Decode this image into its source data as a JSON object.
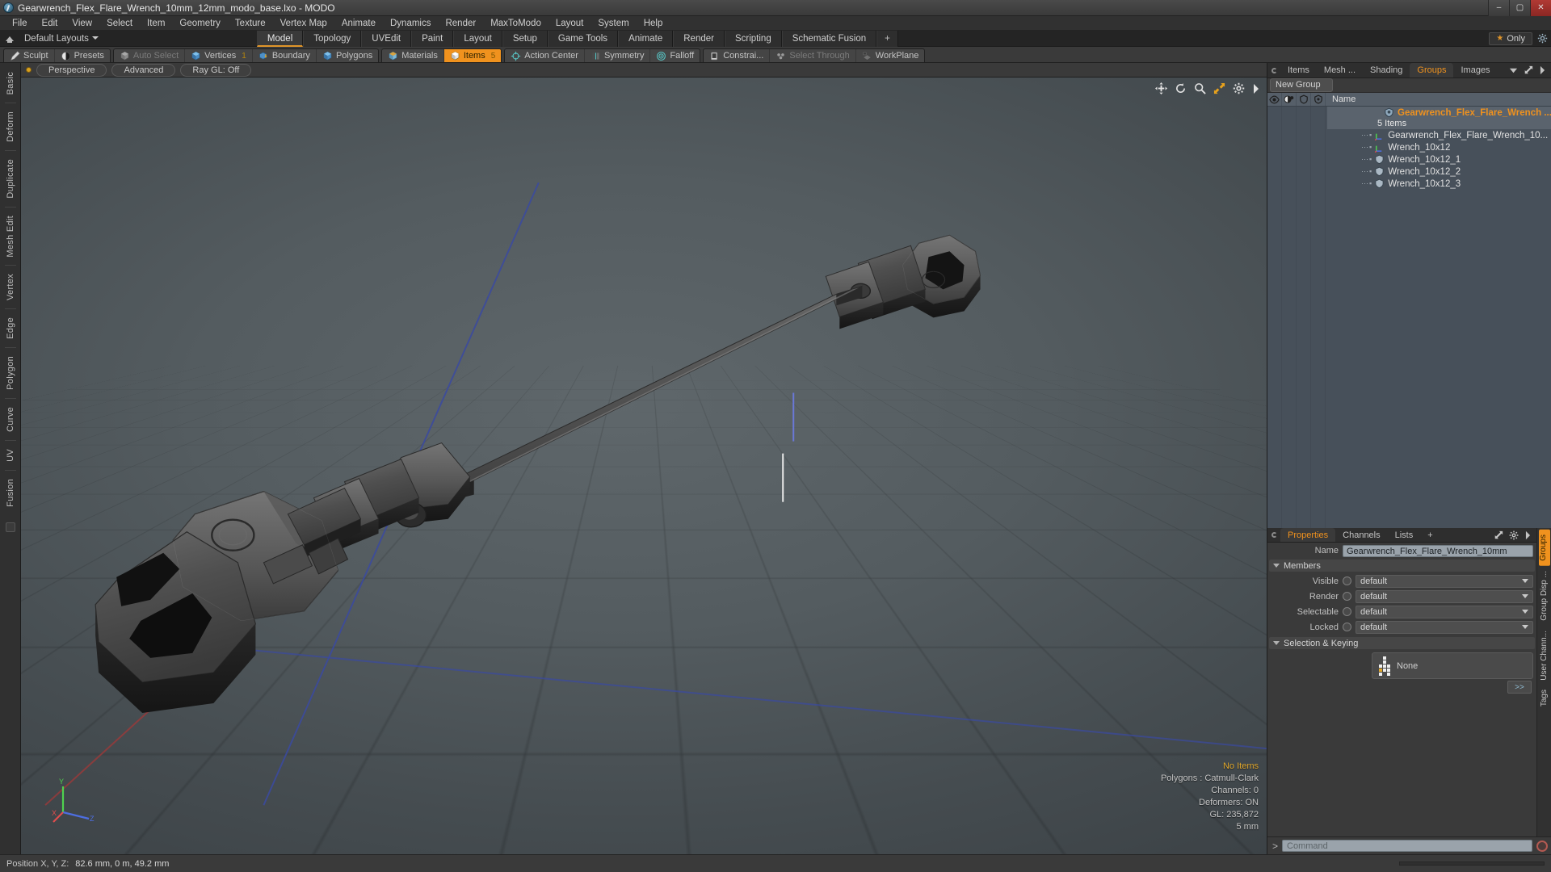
{
  "window": {
    "title": "Gearwrench_Flex_Flare_Wrench_10mm_12mm_modo_base.lxo - MODO",
    "minimize": "–",
    "maximize": "▢",
    "close": "✕"
  },
  "menubar": {
    "items": [
      "File",
      "Edit",
      "View",
      "Select",
      "Item",
      "Geometry",
      "Texture",
      "Vertex Map",
      "Animate",
      "Dynamics",
      "Render",
      "MaxToModo",
      "Layout",
      "System",
      "Help"
    ]
  },
  "layoutbar": {
    "home_label": "",
    "dropdown_label": "Default Layouts",
    "tabs": [
      {
        "label": "Model",
        "active": true
      },
      {
        "label": "Topology",
        "active": false
      },
      {
        "label": "UVEdit",
        "active": false
      },
      {
        "label": "Paint",
        "active": false
      },
      {
        "label": "Layout",
        "active": false
      },
      {
        "label": "Setup",
        "active": false
      },
      {
        "label": "Game Tools",
        "active": false
      },
      {
        "label": "Animate",
        "active": false
      },
      {
        "label": "Render",
        "active": false
      },
      {
        "label": "Scripting",
        "active": false
      },
      {
        "label": "Schematic Fusion",
        "active": false
      },
      {
        "label": "+",
        "active": false
      }
    ],
    "only_label": "Only"
  },
  "modebar": {
    "groups": [
      {
        "buttons": [
          {
            "label": "Sculpt",
            "icon": "pen-icon",
            "state": "normal",
            "count": ""
          },
          {
            "label": "Presets",
            "icon": "sphere-icon",
            "state": "normal",
            "count": ""
          }
        ]
      },
      {
        "buttons": [
          {
            "label": "Auto Select",
            "icon": "cube-gray-icon",
            "state": "disabled",
            "count": ""
          },
          {
            "label": "Vertices",
            "icon": "cube-blue-icon",
            "state": "normal",
            "count": "1"
          },
          {
            "label": "Boundary",
            "icon": "boundary-icon",
            "state": "normal",
            "count": ""
          },
          {
            "label": "Polygons",
            "icon": "cube-blue-icon",
            "state": "normal",
            "count": ""
          }
        ]
      },
      {
        "buttons": [
          {
            "label": "Materials",
            "icon": "cube-amber-icon",
            "state": "normal",
            "count": ""
          },
          {
            "label": "Items",
            "icon": "cube-white-icon",
            "state": "active",
            "count": "5"
          }
        ]
      },
      {
        "buttons": [
          {
            "label": "Action Center",
            "icon": "crosshair-icon",
            "state": "normal",
            "count": ""
          },
          {
            "label": "Symmetry",
            "icon": "symmetry-icon",
            "state": "normal",
            "count": ""
          },
          {
            "label": "Falloff",
            "icon": "target-icon",
            "state": "normal",
            "count": ""
          }
        ]
      },
      {
        "buttons": [
          {
            "label": "Constrai...",
            "icon": "constraint-icon",
            "state": "normal",
            "count": ""
          },
          {
            "label": "Select Through",
            "icon": "select-through-icon",
            "state": "disabled",
            "count": ""
          },
          {
            "label": "WorkPlane",
            "icon": "workplane-icon",
            "state": "normal",
            "count": ""
          }
        ]
      }
    ]
  },
  "leftstrip": {
    "tabs": [
      "Basic",
      "Deform",
      "Duplicate",
      "Mesh Edit",
      "Vertex",
      "Edge",
      "Polygon",
      "Curve",
      "UV",
      "Fusion"
    ]
  },
  "viewport": {
    "header": {
      "view_mode": "Perspective",
      "shading": "Advanced",
      "raygl": "Ray GL: Off"
    },
    "icons": [
      "move-icon",
      "rotate-icon",
      "zoom-icon",
      "fit-icon",
      "gear-icon",
      "chevron-right-icon"
    ],
    "stats": {
      "selection": "No Items",
      "polygons": "Polygons : Catmull-Clark",
      "channels": "Channels: 0",
      "deformers": "Deformers: ON",
      "gl": "GL: 235,872",
      "scale": "5 mm"
    },
    "axis_labels": {
      "x": "X",
      "y": "Y",
      "z": "Z"
    }
  },
  "rightpanel": {
    "tabs": [
      {
        "label": "Items",
        "active": false
      },
      {
        "label": "Mesh ...",
        "active": false
      },
      {
        "label": "Shading",
        "active": false
      },
      {
        "label": "Groups",
        "active": true
      },
      {
        "label": "Images",
        "active": false
      }
    ],
    "new_group_label": "New Group",
    "tree": {
      "columns": [
        "eye-icon",
        "render-icon",
        "selectable-icon",
        "lock-icon"
      ],
      "name_header": "Name",
      "rows": [
        {
          "label": "Gearwrench_Flex_Flare_Wrench ...",
          "icon": "group-icon",
          "level": 0,
          "selected": true,
          "group": true
        },
        {
          "label": "5 Items",
          "icon": "",
          "level": 1,
          "selected": true,
          "group": false,
          "is_count": true
        },
        {
          "label": "Gearwrench_Flex_Flare_Wrench_10...",
          "icon": "locator-icon",
          "level": 1,
          "selected": false,
          "group": false
        },
        {
          "label": "Wrench_10x12",
          "icon": "locator-icon",
          "level": 1,
          "selected": false,
          "group": false
        },
        {
          "label": "Wrench_10x12_1",
          "icon": "mesh-icon",
          "level": 1,
          "selected": false,
          "group": false
        },
        {
          "label": "Wrench_10x12_2",
          "icon": "mesh-icon",
          "level": 1,
          "selected": false,
          "group": false
        },
        {
          "label": "Wrench_10x12_3",
          "icon": "mesh-icon",
          "level": 1,
          "selected": false,
          "group": false
        }
      ]
    },
    "properties": {
      "tabs": [
        {
          "label": "Properties",
          "active": true
        },
        {
          "label": "Channels",
          "active": false
        },
        {
          "label": "Lists",
          "active": false
        },
        {
          "label": "+",
          "active": false
        }
      ],
      "name_label": "Name",
      "name_value": "Gearwrench_Flex_Flare_Wrench_10mm",
      "members_header": "Members",
      "members": [
        {
          "label": "Visible",
          "value": "default"
        },
        {
          "label": "Render",
          "value": "default"
        },
        {
          "label": "Selectable",
          "value": "default"
        },
        {
          "label": "Locked",
          "value": "default"
        }
      ],
      "selection_header": "Selection & Keying",
      "selection_value": "None",
      "go_label": ">>"
    },
    "side_tabs": [
      {
        "label": "Groups",
        "active": true
      },
      {
        "label": "Group Disp ...",
        "active": false
      },
      {
        "label": "User Chann...",
        "active": false
      },
      {
        "label": "Tags",
        "active": false
      }
    ]
  },
  "commandbar": {
    "prompt": ">",
    "placeholder": "Command"
  },
  "statusbar": {
    "position_label": "Position X, Y, Z:",
    "position_value": "82.6 mm, 0 m, 49.2 mm"
  },
  "colors": {
    "accent": "#f0921e",
    "panel": "#3a3a3a",
    "tree_bg": "#47505a",
    "viewport": "#555d61",
    "field": "#9aa3ab"
  }
}
